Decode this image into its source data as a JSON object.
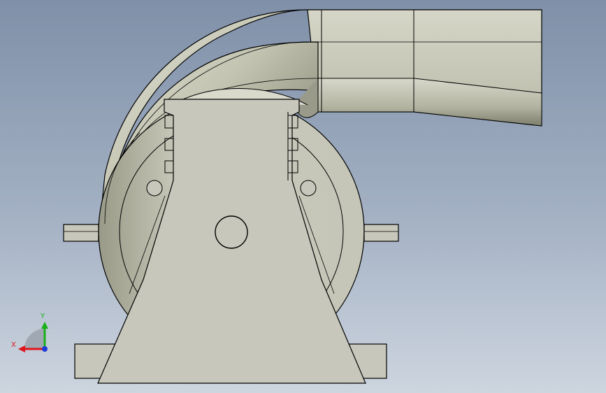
{
  "view": {
    "triad": {
      "x_label": "X",
      "y_label": "Y",
      "x_color": "#e0141b",
      "y_color": "#1ab01a",
      "z_color": "#1e3ad8"
    },
    "colors": {
      "background_top": "#7f90a8",
      "background_bottom": "#cdd5df",
      "body_fill": "#c7c7bb",
      "edge": "#000000"
    }
  }
}
